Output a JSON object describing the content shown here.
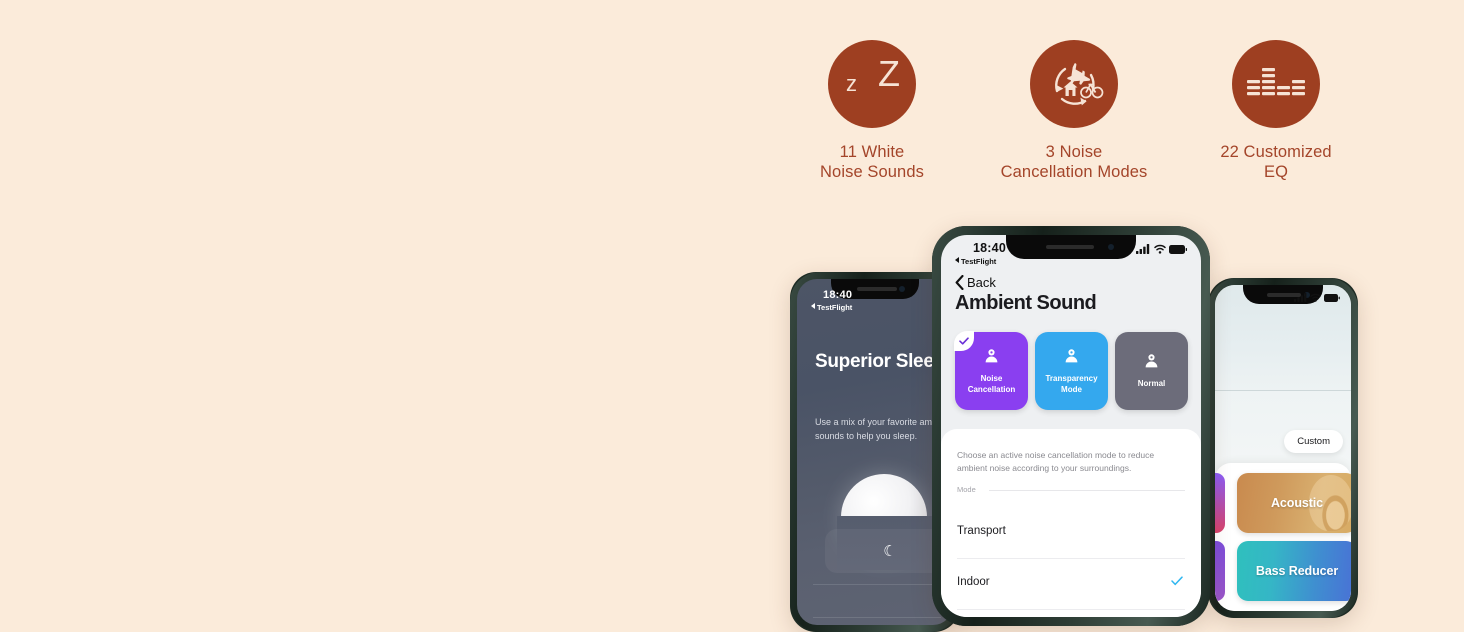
{
  "background_color": "#FBEBDA",
  "accent_color": "#9E3F21",
  "label_color": "#A4452A",
  "features": [
    {
      "icon": "sleep-zz-icon",
      "line1": "11 White",
      "line2": "Noise Sounds"
    },
    {
      "icon": "noise-cancellation-modes-icon",
      "line1": "3 Noise",
      "line2": "Cancellation Modes"
    },
    {
      "icon": "equalizer-icon",
      "line1": "22 Customized",
      "line2": "EQ"
    }
  ],
  "phone_left": {
    "status": {
      "time": "18:40",
      "carrier": "TestFlight"
    },
    "title": "Superior Sleep",
    "subtitle": "Use a mix of your favorite ambient sounds to help you sleep.",
    "card_glyph": "☾"
  },
  "phone_center": {
    "status": {
      "time": "18:40",
      "carrier": "TestFlight"
    },
    "back_label": "Back",
    "page_title": "Ambient Sound",
    "mode_cards": [
      {
        "label_line1": "Noise",
        "label_line2": "Cancellation",
        "color": "#8A3FF0",
        "selected": true
      },
      {
        "label_line1": "Transparency",
        "label_line2": "Mode",
        "color": "#34A8EE",
        "selected": false
      },
      {
        "label_line1": "Normal",
        "label_line2": "",
        "color": "#6C6C7A",
        "selected": false
      }
    ],
    "sheet_description": "Choose an active noise cancellation mode to reduce ambient noise according to your surroundings.",
    "section_header": "Mode",
    "mode_list": [
      {
        "name": "Transport",
        "selected": false
      },
      {
        "name": "Indoor",
        "selected": true
      }
    ],
    "check_color": "#30B7F0"
  },
  "phone_right": {
    "custom_pill": "Custom",
    "eq_presets": [
      {
        "name": "Acoustic"
      },
      {
        "name": "Bass Reducer"
      }
    ]
  }
}
